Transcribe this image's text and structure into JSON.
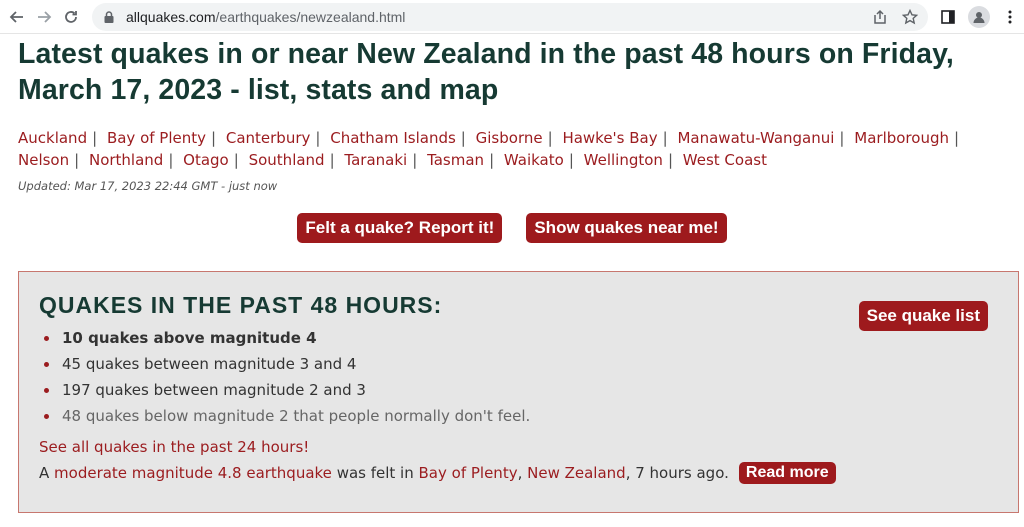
{
  "browser": {
    "url_host": "allquakes.com",
    "url_path": "/earthquakes/newzealand.html"
  },
  "page": {
    "title": "Latest quakes in or near New Zealand in the past 48 hours on Friday, March 17, 2023 - list, stats and map",
    "regions": [
      "Auckland",
      "Bay of Plenty",
      "Canterbury",
      "Chatham Islands",
      "Gisborne",
      "Hawke's Bay",
      "Manawatu-Wanganui",
      "Marlborough",
      "Nelson",
      "Northland",
      "Otago",
      "Southland",
      "Taranaki",
      "Tasman",
      "Waikato",
      "Wellington",
      "West Coast"
    ],
    "updated": "Updated: Mar 17, 2023 22:44 GMT - just now",
    "felt_button": "Felt a quake? Report it!",
    "near_button": "Show quakes near me!"
  },
  "panel": {
    "heading": "QUAKES IN THE PAST 48 HOURS:",
    "see_list_button": "See quake list",
    "stats": [
      "10 quakes above magnitude 4",
      "45 quakes between magnitude 3 and 4",
      "197 quakes between magnitude 2 and 3",
      "48 quakes below magnitude 2 that people normally don't feel."
    ],
    "see_all_link": "See all quakes in the past 24 hours!",
    "felt_prefix": "A ",
    "felt_quake_link": "moderate magnitude 4.8 earthquake",
    "felt_mid": " was felt in ",
    "felt_region_link": "Bay of Plenty",
    "felt_comma": ", ",
    "felt_country_link": "New Zealand",
    "felt_suffix": ", 7 hours ago.",
    "read_more_button": "Read more"
  }
}
